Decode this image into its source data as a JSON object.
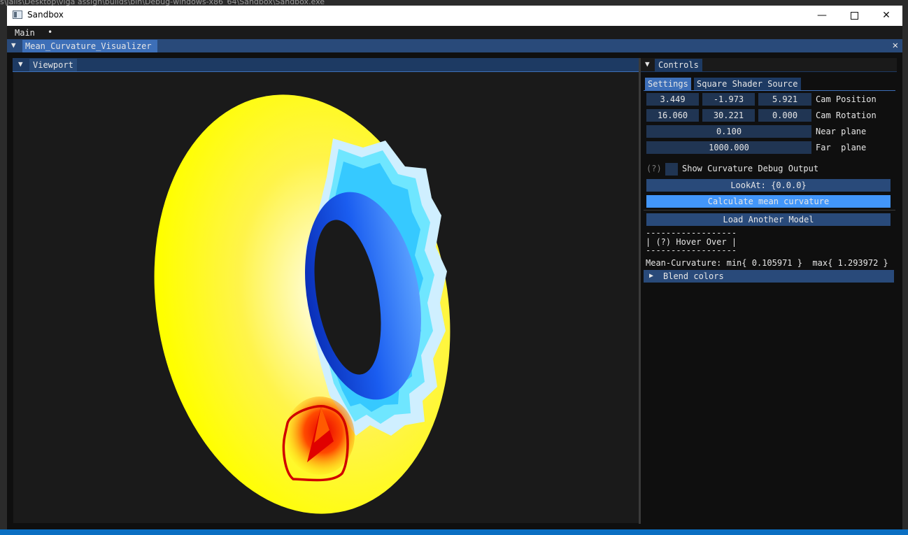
{
  "background": {
    "path_text": "s\\Jalis\\Desktop\\viga assign\\builds\\bin\\Debug-windows-x86_64\\Sandbox\\Sandbox.exe"
  },
  "window": {
    "title": "Sandbox",
    "minimize": "—",
    "close": "✕"
  },
  "menubar": {
    "main": "Main",
    "dot": "•"
  },
  "dock": {
    "tab": "Mean_Curvature_Visualizer",
    "close": "✕"
  },
  "viewport": {
    "tab": "Viewport"
  },
  "controls": {
    "tab": "Controls",
    "tabs": [
      "Settings",
      "Square Shader Source"
    ],
    "cam_position": [
      "3.449",
      "-1.973",
      "5.921"
    ],
    "cam_position_label": "Cam Position",
    "cam_rotation": [
      "16.060",
      "30.221",
      "0.000"
    ],
    "cam_rotation_label": "Cam Rotation",
    "near_plane": "0.100",
    "near_plane_label": "Near plane",
    "far_plane": "1000.000",
    "far_plane_label": "Far  plane",
    "help_marker": "(?)",
    "debug_checkbox_label": "Show Curvature Debug Output",
    "lookat_button": "LookAt: {0.0.0}",
    "calc_button": "Calculate mean curvature",
    "load_button": "Load Another Model",
    "dashes_top": "------------------",
    "hover_text": "| (?) Hover Over |",
    "dashes_bottom": "------------------",
    "curvature_text": "Mean-Curvature: min{ 0.105971 }  max{ 1.293972 }",
    "blend_label": "Blend colors"
  },
  "colors": {
    "accent": "#4296fa",
    "header": "#294a7a",
    "field": "#203553",
    "torus_low": "#ffff00",
    "torus_mid": "#5ce1ff",
    "torus_high": "#0b3fd6",
    "highlight": "#e00000"
  }
}
